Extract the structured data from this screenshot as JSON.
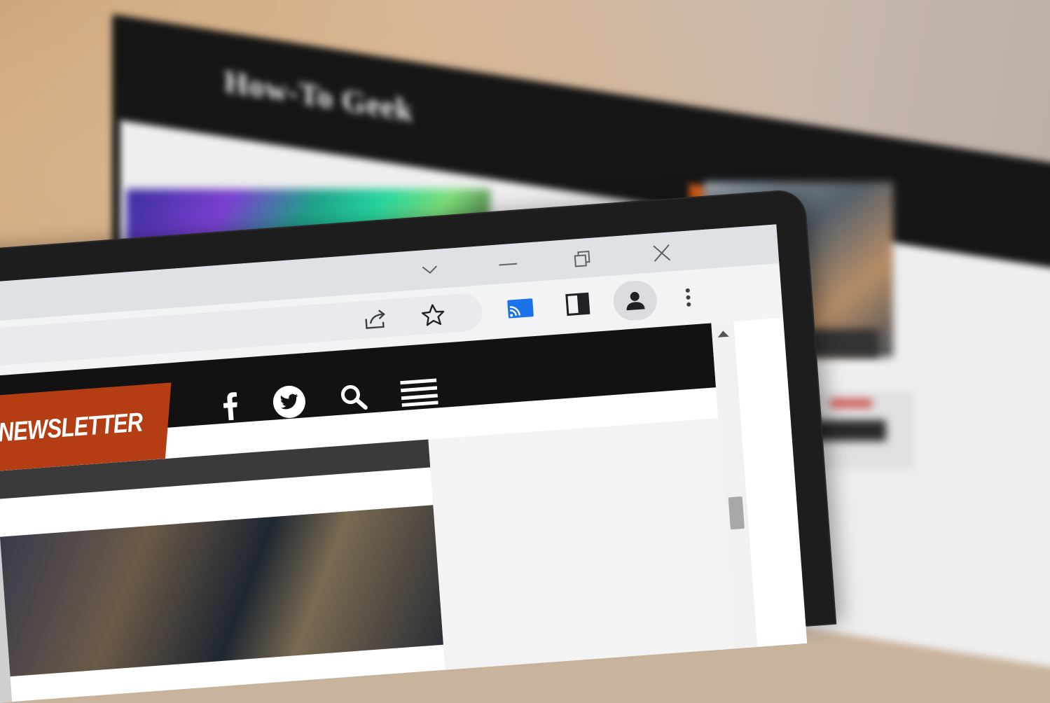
{
  "background": {
    "monitor_logo_text": "How-To Geek"
  },
  "browser": {
    "titlebar": {
      "tab_search_icon": "chevron-down-icon",
      "minimize_icon": "minimize-icon",
      "restore_icon": "restore-icon",
      "close_icon": "close-icon"
    },
    "toolbar": {
      "icons": [
        "share-icon",
        "bookmark-star-icon",
        "cast-icon",
        "side-panel-icon",
        "profile-icon",
        "menu-dots-icon"
      ]
    },
    "page": {
      "newsletter_label": "FREE NEWSLETTER",
      "header_icons": [
        "facebook-icon",
        "twitter-icon",
        "search-icon",
        "hamburger-menu-icon"
      ]
    }
  },
  "colors": {
    "newsletter_orange": "#b43d13",
    "site_header_black": "#121212",
    "cast_blue": "#1a73e8"
  }
}
